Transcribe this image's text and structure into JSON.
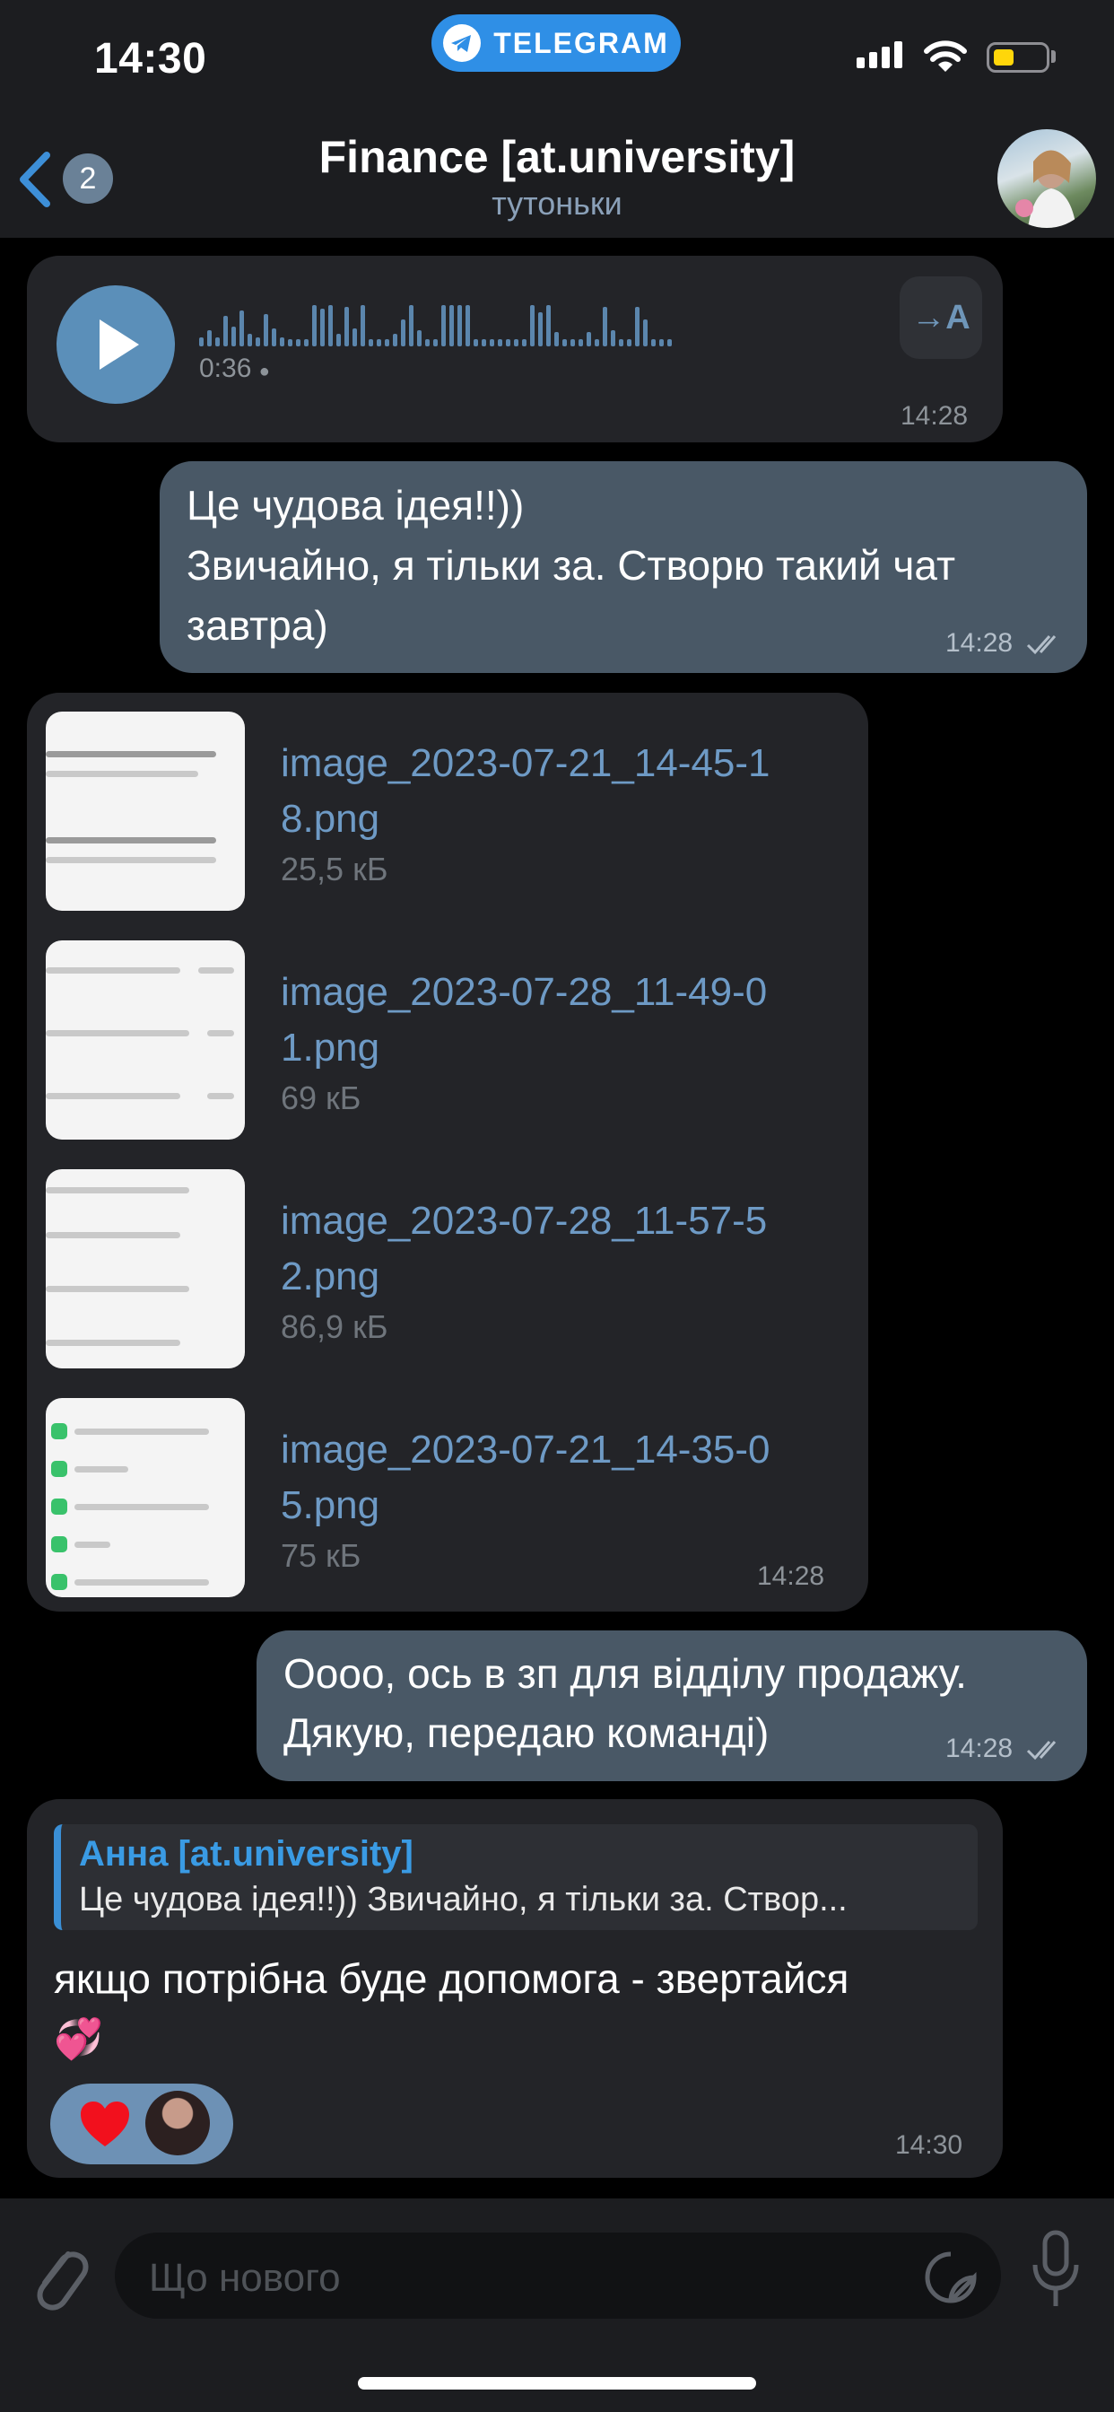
{
  "status_bar": {
    "time": "14:30",
    "app_pill": "TELEGRAM"
  },
  "header": {
    "back_count": "2",
    "title": "Finance [at.university]",
    "subtitle": "тутоньки"
  },
  "messages": {
    "voice": {
      "duration": "0:36",
      "time": "14:28",
      "transcribe_icon": "→A"
    },
    "outgoing1": {
      "lines": [
        "Це чудова ідея!!))",
        "Звичайно, я тільки за. Створю такий чат",
        "завтра)"
      ],
      "time": "14:28"
    },
    "files": {
      "items": [
        {
          "name_line1": "image_2023-07-21_14-45-1",
          "name_line2": "8.png",
          "size": "25,5 кБ"
        },
        {
          "name_line1": "image_2023-07-28_11-49-0",
          "name_line2": "1.png",
          "size": "69 кБ"
        },
        {
          "name_line1": "image_2023-07-28_11-57-5",
          "name_line2": "2.png",
          "size": "86,9 кБ"
        },
        {
          "name_line1": "image_2023-07-21_14-35-0",
          "name_line2": "5.png",
          "size": "75 кБ"
        }
      ],
      "time": "14:28"
    },
    "outgoing2": {
      "lines": [
        "Оооо, ось в зп для відділу продажу.",
        "Дякую, передаю команді)"
      ],
      "time": "14:28"
    },
    "reply_msg": {
      "reply_author": "Анна [at.university]",
      "reply_text": "Це чудова ідея!!)) Звичайно, я тільки за. Створ...",
      "text": "якщо потрібна буде допомога - звертайся",
      "emoji": "💞",
      "reaction": "❤️",
      "time": "14:30"
    }
  },
  "composer": {
    "placeholder": "Що нового"
  },
  "colors": {
    "accent": "#2f8fe6",
    "outgoing_bubble": "#495866",
    "incoming_bubble": "#232428",
    "link": "#6e9ac5"
  }
}
